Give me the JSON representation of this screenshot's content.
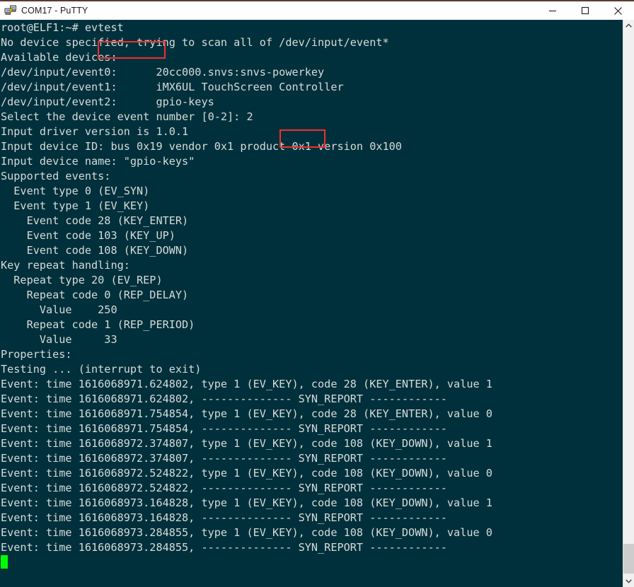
{
  "window": {
    "title": "COM17 - PuTTY",
    "icon": "putty-icon",
    "controls": {
      "minimize_label": "Minimize",
      "maximize_label": "Maximize",
      "close_label": "Close"
    }
  },
  "theme": {
    "terminal_background": "#00303b",
    "terminal_foreground": "#d6dbdb",
    "cursor_color": "#00ff00",
    "annotation_color": "#f03030",
    "titlebar_accent": "#5b3a2e",
    "scrollbar_track": "#f0f0f0",
    "scrollbar_thumb": "#cdcdcd"
  },
  "terminal": {
    "prompt": "root@ELF1:~#",
    "command": "evtest",
    "selected_device_number": "2",
    "lines": [
      "root@ELF1:~# evtest",
      "No device specified, trying to scan all of /dev/input/event*",
      "Available devices:",
      "/dev/input/event0:      20cc000.snvs:snvs-powerkey",
      "/dev/input/event1:      iMX6UL TouchScreen Controller",
      "/dev/input/event2:      gpio-keys",
      "Select the device event number [0-2]: 2",
      "Input driver version is 1.0.1",
      "Input device ID: bus 0x19 vendor 0x1 product 0x1 version 0x100",
      "Input device name: \"gpio-keys\"",
      "Supported events:",
      "  Event type 0 (EV_SYN)",
      "  Event type 1 (EV_KEY)",
      "    Event code 28 (KEY_ENTER)",
      "    Event code 103 (KEY_UP)",
      "    Event code 108 (KEY_DOWN)",
      "Key repeat handling:",
      "  Repeat type 20 (EV_REP)",
      "    Repeat code 0 (REP_DELAY)",
      "      Value    250",
      "    Repeat code 1 (REP_PERIOD)",
      "      Value     33",
      "Properties:",
      "Testing ... (interrupt to exit)",
      "Event: time 1616068971.624802, type 1 (EV_KEY), code 28 (KEY_ENTER), value 1",
      "Event: time 1616068971.624802, -------------- SYN_REPORT ------------",
      "Event: time 1616068971.754854, type 1 (EV_KEY), code 28 (KEY_ENTER), value 0",
      "Event: time 1616068971.754854, -------------- SYN_REPORT ------------",
      "Event: time 1616068972.374807, type 1 (EV_KEY), code 108 (KEY_DOWN), value 1",
      "Event: time 1616068972.374807, -------------- SYN_REPORT ------------",
      "Event: time 1616068972.524822, type 1 (EV_KEY), code 108 (KEY_DOWN), value 0",
      "Event: time 1616068972.524822, -------------- SYN_REPORT ------------",
      "Event: time 1616068973.164828, type 1 (EV_KEY), code 108 (KEY_DOWN), value 1",
      "Event: time 1616068973.164828, -------------- SYN_REPORT ------------",
      "Event: time 1616068973.284855, type 1 (EV_KEY), code 108 (KEY_DOWN), value 0",
      "Event: time 1616068973.284855, -------------- SYN_REPORT ------------"
    ],
    "devices": [
      {
        "node": "/dev/input/event0",
        "name": "20cc000.snvs:snvs-powerkey"
      },
      {
        "node": "/dev/input/event1",
        "name": "iMX6UL TouchScreen Controller"
      },
      {
        "node": "/dev/input/event2",
        "name": "gpio-keys"
      }
    ],
    "device_info": {
      "driver_version": "1.0.1",
      "bus": "0x19",
      "vendor": "0x1",
      "product": "0x1",
      "version": "0x100",
      "name": "gpio-keys"
    },
    "supported_events": [
      {
        "type": "0",
        "label": "EV_SYN",
        "codes": []
      },
      {
        "type": "1",
        "label": "EV_KEY",
        "codes": [
          {
            "code": "28",
            "label": "KEY_ENTER"
          },
          {
            "code": "103",
            "label": "KEY_UP"
          },
          {
            "code": "108",
            "label": "KEY_DOWN"
          }
        ]
      }
    ],
    "key_repeat": {
      "type": "20",
      "type_label": "EV_REP",
      "entries": [
        {
          "code": "0",
          "label": "REP_DELAY",
          "value": "250"
        },
        {
          "code": "1",
          "label": "REP_PERIOD",
          "value": "33"
        }
      ]
    },
    "events": [
      {
        "time": "1616068971.624802",
        "type": "1",
        "type_label": "EV_KEY",
        "code": "28",
        "code_label": "KEY_ENTER",
        "value": "1"
      },
      {
        "time": "1616068971.624802",
        "syn": "SYN_REPORT"
      },
      {
        "time": "1616068971.754854",
        "type": "1",
        "type_label": "EV_KEY",
        "code": "28",
        "code_label": "KEY_ENTER",
        "value": "0"
      },
      {
        "time": "1616068971.754854",
        "syn": "SYN_REPORT"
      },
      {
        "time": "1616068972.374807",
        "type": "1",
        "type_label": "EV_KEY",
        "code": "108",
        "code_label": "KEY_DOWN",
        "value": "1"
      },
      {
        "time": "1616068972.374807",
        "syn": "SYN_REPORT"
      },
      {
        "time": "1616068972.524822",
        "type": "1",
        "type_label": "EV_KEY",
        "code": "108",
        "code_label": "KEY_DOWN",
        "value": "0"
      },
      {
        "time": "1616068972.524822",
        "syn": "SYN_REPORT"
      },
      {
        "time": "1616068973.164828",
        "type": "1",
        "type_label": "EV_KEY",
        "code": "108",
        "code_label": "KEY_DOWN",
        "value": "1"
      },
      {
        "time": "1616068973.164828",
        "syn": "SYN_REPORT"
      },
      {
        "time": "1616068973.284855",
        "type": "1",
        "type_label": "EV_KEY",
        "code": "108",
        "code_label": "KEY_DOWN",
        "value": "0"
      },
      {
        "time": "1616068973.284855",
        "syn": "SYN_REPORT"
      }
    ]
  },
  "scrollbar": {
    "up_arrow": "chevron-up-icon",
    "down_arrow": "chevron-down-icon"
  }
}
